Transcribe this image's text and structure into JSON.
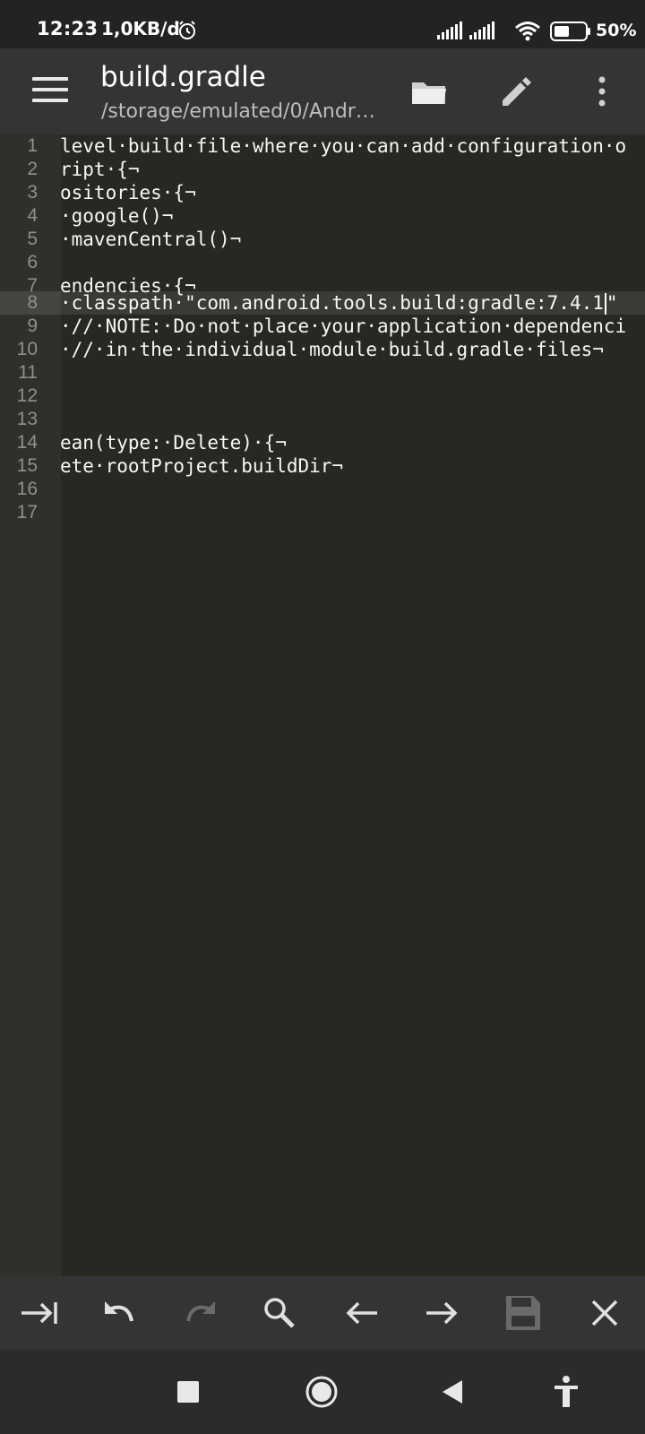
{
  "status": {
    "time": "12:23",
    "net_speed": "1,0KB/d",
    "battery": "50%"
  },
  "appbar": {
    "title": "build.gradle",
    "subtitle": "/storage/emulated/0/Andr…"
  },
  "editor": {
    "current_line": 8,
    "lines": [
      {
        "n": "1",
        "text": "level·build·file·where·you·can·add·configuration·o"
      },
      {
        "n": "2",
        "text": "ript·{¬"
      },
      {
        "n": "3",
        "text": "ositories·{¬"
      },
      {
        "n": "4",
        "text": "·google()¬"
      },
      {
        "n": "5",
        "text": "·mavenCentral()¬"
      },
      {
        "n": "6",
        "text": ""
      },
      {
        "n": "7",
        "text": "endencies·{¬"
      },
      {
        "n": "8",
        "text": "·classpath·\"com.android.tools.build:gradle:7.4.1",
        "after_cursor": "\""
      },
      {
        "n": "9",
        "text": "·//·NOTE:·Do·not·place·your·application·dependenci"
      },
      {
        "n": "10",
        "text": "·//·in·the·individual·module·build.gradle·files¬"
      },
      {
        "n": "11",
        "text": ""
      },
      {
        "n": "12",
        "text": ""
      },
      {
        "n": "13",
        "text": ""
      },
      {
        "n": "14",
        "text": "ean(type:·Delete)·{¬"
      },
      {
        "n": "15",
        "text": "ete·rootProject.buildDir¬"
      },
      {
        "n": "16",
        "text": ""
      },
      {
        "n": "17",
        "text": ""
      }
    ]
  },
  "toolbar": {
    "icons": [
      "tab-icon",
      "undo-icon",
      "redo-icon",
      "search-icon",
      "arrow-left-icon",
      "arrow-right-icon",
      "save-icon",
      "close-icon"
    ]
  },
  "navbar": {
    "icons": [
      "recents-icon",
      "home-icon",
      "back-icon",
      "accessibility-icon"
    ]
  },
  "colors": {
    "editor_bg": "#272822",
    "gutter_bg": "#2f302b",
    "appbar_bg": "#343434",
    "text": "#f8f8f2"
  }
}
